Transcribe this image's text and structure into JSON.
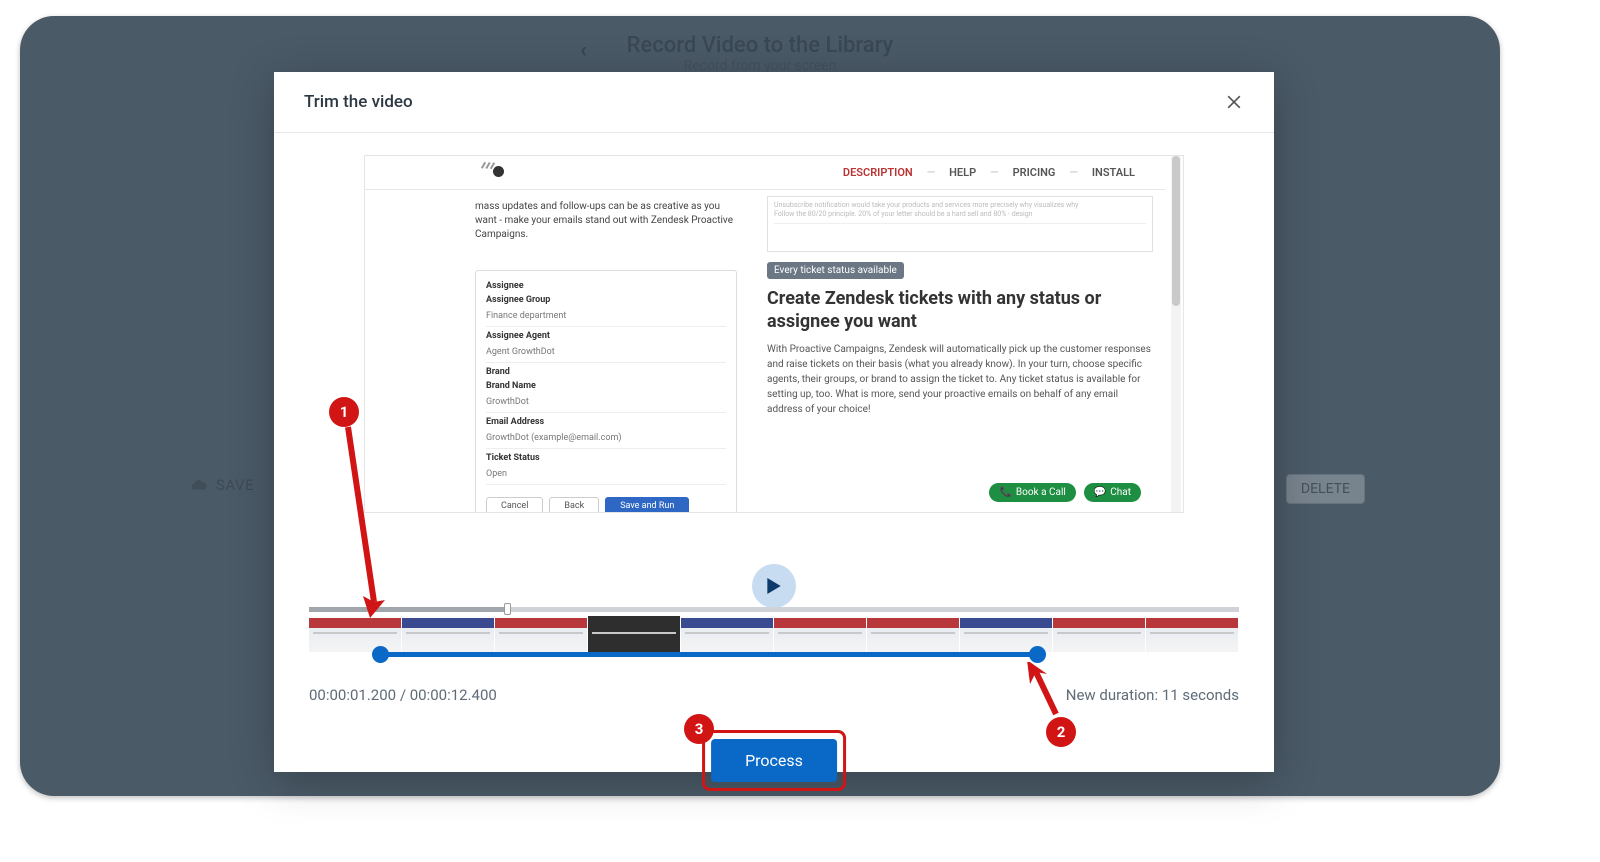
{
  "background": {
    "back_icon": "‹",
    "title": "Record Video to the Library",
    "subtitle": "Record from your screen",
    "save_label": "SAVE",
    "delete_label": "DELETE"
  },
  "modal": {
    "title": "Trim the video"
  },
  "preview": {
    "nav": {
      "description": "DESCRIPTION",
      "help": "HELP",
      "pricing": "PRICING",
      "install": "INSTALL"
    },
    "left_intro": "mass updates and follow-ups can be as creative as you want - make your emails stand out with Zendesk Proactive Campaigns.",
    "form": {
      "assignee_lbl": "Assignee",
      "group_lbl": "Assignee Group",
      "group_val": "Finance department",
      "agent_lbl": "Assignee Agent",
      "agent_val": "Agent GrowthDot",
      "brand_lbl": "Brand",
      "brandname_lbl": "Brand Name",
      "brandname_val": "GrowthDot",
      "email_lbl": "Email Address",
      "email_val": "GrowthDot (example@email.com)",
      "status_lbl": "Ticket Status",
      "status_val": "Open",
      "cancel": "Cancel",
      "back": "Back",
      "run": "Save and Run"
    },
    "right": {
      "mini_line1": "Unsubscribe notification would take your products and services more precisely why visualizes why",
      "mini_line2": "Follow the 80/20 principle. 20% of your letter should be a hard sell and 80% - design",
      "badge": "Every ticket status available",
      "heading": "Create Zendesk tickets with any status or assignee you want",
      "para": "With Proactive Campaigns, Zendesk will automatically pick up the customer responses and raise tickets on their basis (what you already know). In your turn, choose specific agents, their groups, or brand to assign the ticket to. Any ticket status is available for setting up, too. What is more, send your proactive emails on behalf of any email address of your choice!",
      "cta_book": "Book a Call",
      "cta_chat": "Chat"
    }
  },
  "timeline": {
    "time_text": "00:00:01.200 / 00:00:12.400",
    "duration_text": "New duration: 11 seconds"
  },
  "process_label": "Process",
  "annotations": {
    "a1": "1",
    "a2": "2",
    "a3": "3"
  }
}
